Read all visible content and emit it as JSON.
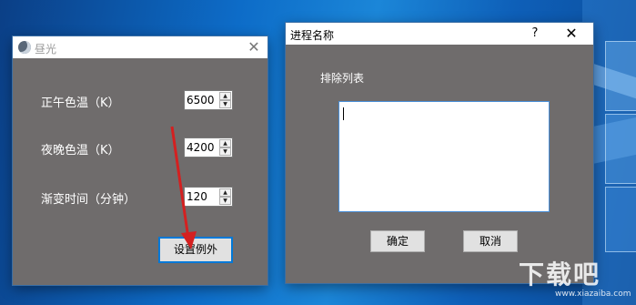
{
  "main_window": {
    "title": "昼光",
    "close_label": "✕",
    "fields": [
      {
        "label": "正午色温（K）",
        "value": "6500"
      },
      {
        "label": "夜晚色温（K）",
        "value": "4200"
      },
      {
        "label": "渐变时间（分钟）",
        "value": "120"
      }
    ],
    "set_exception_button": "设置例外"
  },
  "dialog": {
    "title": "进程名称",
    "help_label": "?",
    "close_label": "✕",
    "exclude_list_label": "排除列表",
    "exclude_list_value": "",
    "ok_button": "确定",
    "cancel_button": "取消"
  },
  "spinner_glyphs": {
    "up": "▲",
    "down": "▼"
  },
  "annotation": {
    "arrow_color": "#d42020"
  },
  "watermark": {
    "text": "下载吧",
    "subtext": "www.xiazaiba.com"
  }
}
